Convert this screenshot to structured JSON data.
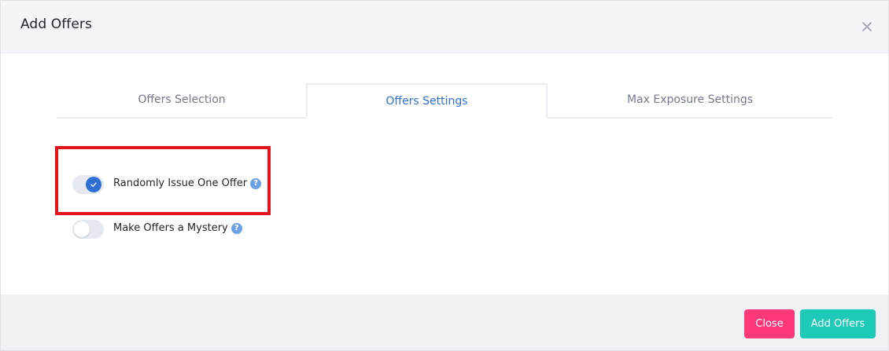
{
  "modal": {
    "title": "Add Offers"
  },
  "tabs": [
    {
      "label": "Offers Selection",
      "active": false
    },
    {
      "label": "Offers Settings",
      "active": true
    },
    {
      "label": "Max Exposure Settings",
      "active": false
    }
  ],
  "settings": [
    {
      "label": "Randomly Issue One Offer",
      "enabled": true,
      "help": "?"
    },
    {
      "label": "Make Offers a Mystery",
      "enabled": false,
      "help": "?"
    }
  ],
  "footer": {
    "close_label": "Close",
    "add_label": "Add Offers"
  },
  "colors": {
    "accent": "#2f6fd6",
    "close_button": "#fd397a",
    "add_button": "#1dc9b7",
    "highlight": "#e0131e"
  },
  "icons": {
    "close": "close-icon",
    "check": "check-icon",
    "help": "question-circle-icon"
  }
}
